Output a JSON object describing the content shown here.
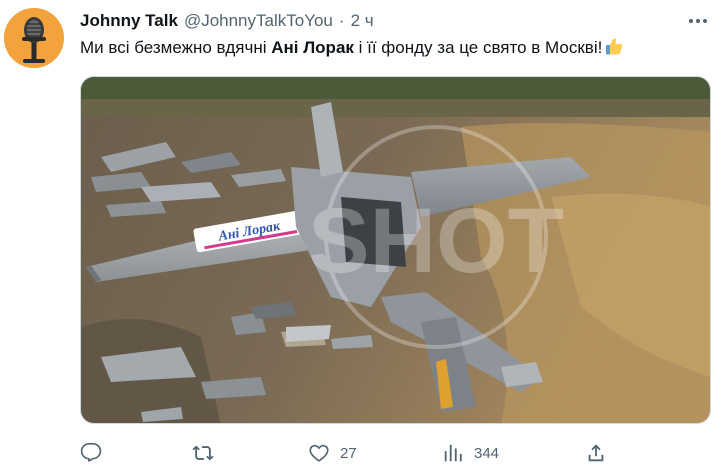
{
  "tweet": {
    "author_name": "Johnny Talk",
    "author_handle": "@JohnnyTalkToYou",
    "separator": "·",
    "time": "2 ч",
    "text_before": "Ми всі безмежно вдячні ",
    "text_bold": "Ані Лорак",
    "text_after": " і її фонду за це свято в Москві!",
    "emoji": "thumbs-up",
    "image": {
      "wing_label": "Ані Лорак",
      "watermark": "SHOT"
    }
  },
  "actions": {
    "reply_count": "",
    "retweet_count": "",
    "like_count": "27",
    "views_count": "344"
  },
  "colors": {
    "text": "#0f1419",
    "secondary": "#536471",
    "avatar_bg": "#f3a33e"
  }
}
